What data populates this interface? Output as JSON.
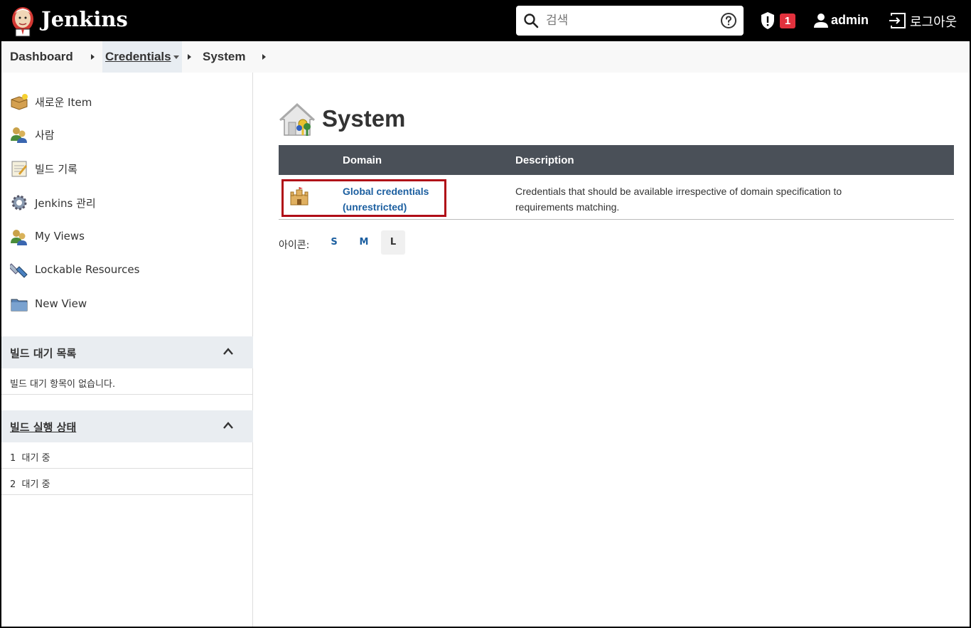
{
  "header": {
    "brand": "Jenkins",
    "search_placeholder": "검색",
    "security_badge": "1",
    "user": "admin",
    "logout": "로그아웃"
  },
  "breadcrumb": [
    "Dashboard",
    "Credentials",
    "System"
  ],
  "sidebar": {
    "items": [
      {
        "label": "새로운 Item",
        "icon": "new-item-icon"
      },
      {
        "label": "사람",
        "icon": "people-icon"
      },
      {
        "label": "빌드 기록",
        "icon": "notepad-icon"
      },
      {
        "label": "Jenkins 관리",
        "icon": "gear-icon"
      },
      {
        "label": "My Views",
        "icon": "people-icon"
      },
      {
        "label": "Lockable Resources",
        "icon": "usb-icon"
      },
      {
        "label": "New View",
        "icon": "folder-icon"
      }
    ],
    "queue": {
      "title": "빌드 대기 목록",
      "empty": "빌드 대기 항목이 없습니다."
    },
    "executors": {
      "title": "빌드 실행 상태",
      "rows": [
        "1  대기 중",
        "2  대기 중"
      ]
    }
  },
  "main": {
    "title": "System",
    "table": {
      "headers": {
        "domain": "Domain",
        "description": "Description"
      },
      "rows": [
        {
          "domain": "Global credentials (unrestricted)",
          "description": "Credentials that should be available irrespective of domain specification to requirements matching."
        }
      ]
    },
    "icon_size": {
      "label": "아이콘:",
      "options": [
        "S",
        "M",
        "L"
      ],
      "selected": "L"
    }
  }
}
